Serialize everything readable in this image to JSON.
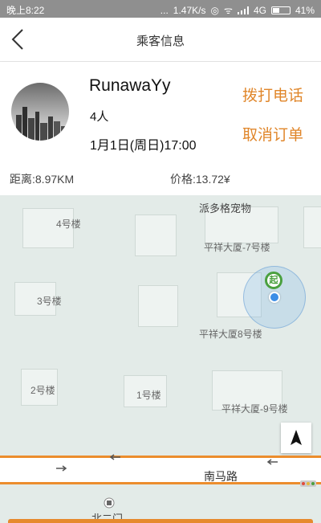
{
  "status": {
    "time": "晚上8:22",
    "dots": "...",
    "speed": "1.47K/s",
    "network": "4G",
    "battery": "41%",
    "battery_level": 0.41
  },
  "header": {
    "title": "乘客信息"
  },
  "passenger": {
    "name": "RunawaYy",
    "count": "4人",
    "time": "1月1日(周日)17:00",
    "distance": "距离:8.97KM",
    "price": "价格:13.72¥"
  },
  "actions": {
    "call": "拨打电话",
    "cancel": "取消订单"
  },
  "map": {
    "poi": "派多格宠物",
    "labels": [
      "4号楼",
      "平祥大厦-7号楼",
      "3号楼",
      "平祥大厦8号楼",
      "2号楼",
      "1号楼",
      "平祥大厦-9号楼",
      "北二门"
    ],
    "road": "南马路",
    "start_marker": "起"
  },
  "colors": {
    "accent": "#e0862a",
    "route": "#ec8d2d",
    "location": "#3b8de6",
    "start": "#4aa03f"
  }
}
